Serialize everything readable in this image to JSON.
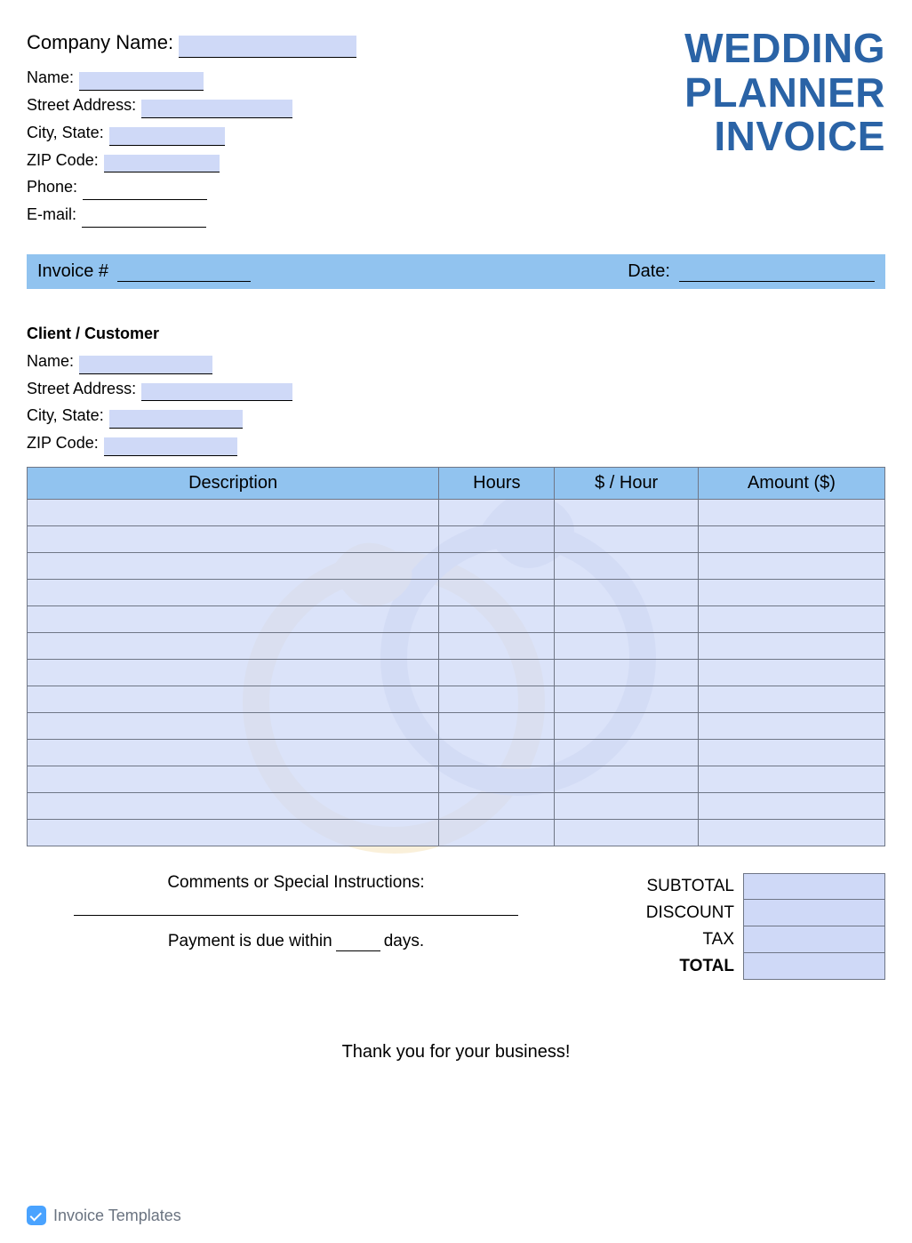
{
  "title": {
    "line1": "WEDDING",
    "line2": "PLANNER",
    "line3": "INVOICE"
  },
  "company": {
    "company_name_label": "Company Name:",
    "name_label": "Name:",
    "street_label": "Street Address:",
    "city_label": "City, State:",
    "zip_label": "ZIP Code:",
    "phone_label": "Phone:",
    "email_label": "E-mail:",
    "company_name_value": "",
    "name_value": "",
    "street_value": "",
    "city_value": "",
    "zip_value": "",
    "phone_value": "",
    "email_value": ""
  },
  "bar": {
    "invoice_label": "Invoice #",
    "invoice_value": "",
    "date_label": "Date:",
    "date_value": ""
  },
  "client": {
    "header": "Client / Customer",
    "name_label": "Name:",
    "street_label": "Street Address:",
    "city_label": "City, State:",
    "zip_label": "ZIP Code:",
    "name_value": "",
    "street_value": "",
    "city_value": "",
    "zip_value": ""
  },
  "table": {
    "headers": {
      "description": "Description",
      "hours": "Hours",
      "rate": "$ / Hour",
      "amount": "Amount ($)"
    },
    "row_count": 13
  },
  "comments": {
    "label": "Comments or Special Instructions:",
    "value": "",
    "pay_prefix": "Payment is due within",
    "pay_suffix": "days.",
    "days_value": ""
  },
  "totals": {
    "subtotal_label": "SUBTOTAL",
    "discount_label": "DISCOUNT",
    "tax_label": "TAX",
    "total_label": "TOTAL",
    "subtotal_value": "",
    "discount_value": "",
    "tax_value": "",
    "total_value": ""
  },
  "thanks": "Thank you for your business!",
  "footer": "Invoice Templates"
}
